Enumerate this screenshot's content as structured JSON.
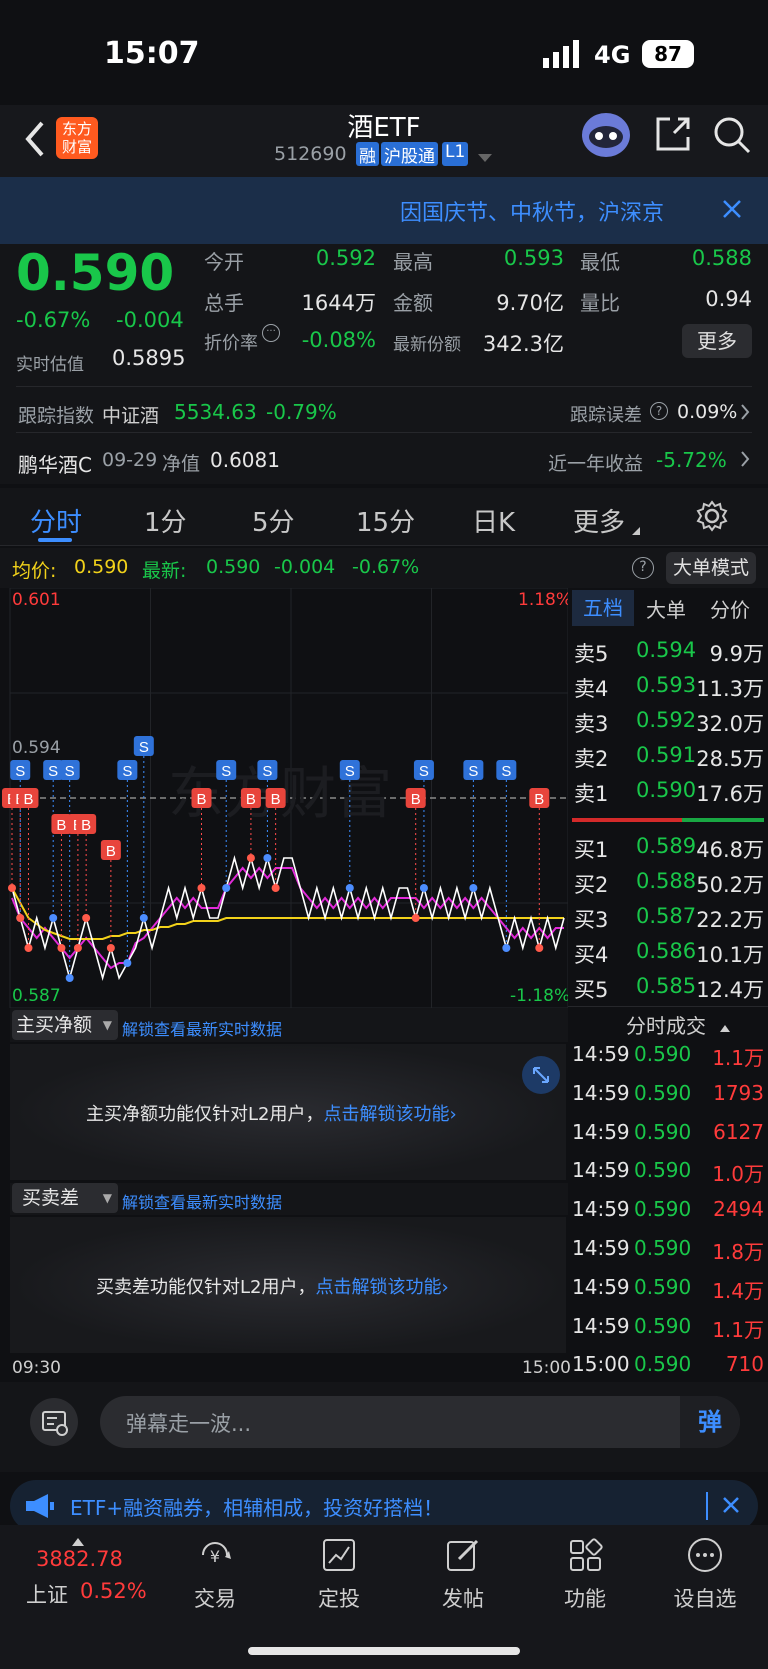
{
  "status": {
    "time": "15:07",
    "network": "4G",
    "battery": "87"
  },
  "nav": {
    "title": "酒ETF",
    "code": "512690",
    "badges": [
      "融",
      "沪股通",
      "L1"
    ],
    "logo_line1": "东方",
    "logo_line2": "财富"
  },
  "notice": {
    "text": "因国庆节、中秋节，沪深京"
  },
  "quote": {
    "price": "0.590",
    "change_pct": "-0.67%",
    "change": "-0.004",
    "estimate_label": "实时估值",
    "estimate": "0.5895",
    "fields": [
      {
        "label": "今开",
        "value": "0.592",
        "color": "green"
      },
      {
        "label": "最高",
        "value": "0.593",
        "color": "green"
      },
      {
        "label": "最低",
        "value": "0.588",
        "color": "green"
      },
      {
        "label": "总手",
        "value": "1644万",
        "color": "white"
      },
      {
        "label": "金额",
        "value": "9.70亿",
        "color": "white"
      },
      {
        "label": "量比",
        "value": "0.94",
        "color": "white"
      },
      {
        "label": "折价率",
        "value": "-0.08%",
        "color": "green"
      },
      {
        "label": "最新份额",
        "value": "342.3亿",
        "color": "white"
      }
    ],
    "more_button": "更多",
    "track_label": "跟踪指数",
    "track_index": "中证酒",
    "track_value": "5534.63",
    "track_pct": "-0.79%",
    "track_error_label": "跟踪误差",
    "track_error": "0.09%",
    "fund_name": "鹏华酒C",
    "fund_date": "09-29",
    "nav_label": "净值",
    "nav_value": "0.6081",
    "year_return_label": "近一年收益",
    "year_return": "-5.72%"
  },
  "tabs": [
    "分时",
    "1分",
    "5分",
    "15分",
    "日K",
    "更多"
  ],
  "chartbar": {
    "avg_label": "均价:",
    "avg": "0.590",
    "latest_label": "最新:",
    "latest": "0.590",
    "latest_change": "-0.004",
    "latest_pct": "-0.67%",
    "mode_button": "大单模式"
  },
  "chart_data": {
    "type": "line",
    "y_max_label": "0.601",
    "y_min_label": "0.587",
    "pct_max_label": "1.18%",
    "pct_min_label": "-1.18%",
    "ref_label": "0.594",
    "ylim": [
      0.587,
      0.601
    ],
    "x_start": "09:30",
    "x_end": "15:00",
    "watermark": "东方财富",
    "series": [
      {
        "name": "price",
        "color": "#ffffff",
        "values": [
          0.591,
          0.59,
          0.589,
          0.59,
          0.589,
          0.59,
          0.589,
          0.588,
          0.589,
          0.59,
          0.589,
          0.588,
          0.589,
          0.588,
          0.5885,
          0.589,
          0.59,
          0.589,
          0.59,
          0.591,
          0.59,
          0.591,
          0.59,
          0.591,
          0.59,
          0.59,
          0.591,
          0.592,
          0.591,
          0.592,
          0.591,
          0.592,
          0.591,
          0.592,
          0.592,
          0.591,
          0.59,
          0.591,
          0.59,
          0.591,
          0.59,
          0.591,
          0.59,
          0.591,
          0.59,
          0.591,
          0.59,
          0.591,
          0.591,
          0.59,
          0.591,
          0.59,
          0.591,
          0.59,
          0.591,
          0.59,
          0.591,
          0.59,
          0.591,
          0.59,
          0.589,
          0.59,
          0.589,
          0.59,
          0.589,
          0.59,
          0.589,
          0.59
        ]
      },
      {
        "name": "avg",
        "color": "#f2d21a",
        "values": [
          0.591,
          0.5905,
          0.59,
          0.5898,
          0.5896,
          0.5895,
          0.5894,
          0.5893,
          0.5893,
          0.5893,
          0.5893,
          0.5893,
          0.5894,
          0.5894,
          0.5895,
          0.5895,
          0.5896,
          0.5896,
          0.5897,
          0.5897,
          0.5898,
          0.5898,
          0.5899,
          0.5899,
          0.5899,
          0.5899,
          0.59,
          0.59,
          0.59,
          0.59,
          0.59,
          0.59,
          0.59,
          0.59,
          0.59,
          0.59,
          0.59,
          0.59,
          0.59,
          0.59,
          0.59,
          0.59,
          0.59,
          0.59,
          0.59,
          0.59,
          0.59,
          0.59,
          0.59,
          0.59,
          0.59,
          0.59,
          0.59,
          0.59,
          0.59,
          0.59,
          0.59,
          0.59,
          0.59,
          0.59,
          0.59,
          0.59,
          0.59,
          0.59,
          0.59,
          0.59,
          0.59,
          0.59
        ]
      }
    ],
    "markers_S": [
      1,
      5,
      7,
      14,
      16,
      26,
      31,
      41,
      50,
      56,
      60
    ],
    "markers_B": [
      0,
      1,
      2,
      6,
      8,
      9,
      12,
      23,
      29,
      32,
      49,
      64
    ]
  },
  "book": {
    "tabs": [
      "五档",
      "大单",
      "分价"
    ],
    "asks": [
      {
        "label": "卖5",
        "price": "0.594",
        "vol": "9.9万"
      },
      {
        "label": "卖4",
        "price": "0.593",
        "vol": "11.3万"
      },
      {
        "label": "卖3",
        "price": "0.592",
        "vol": "32.0万"
      },
      {
        "label": "卖2",
        "price": "0.591",
        "vol": "28.5万"
      },
      {
        "label": "卖1",
        "price": "0.590",
        "vol": "17.6万"
      }
    ],
    "bids": [
      {
        "label": "买1",
        "price": "0.589",
        "vol": "46.8万"
      },
      {
        "label": "买2",
        "price": "0.588",
        "vol": "50.2万"
      },
      {
        "label": "买3",
        "price": "0.587",
        "vol": "22.2万"
      },
      {
        "label": "买4",
        "price": "0.586",
        "vol": "10.1万"
      },
      {
        "label": "买5",
        "price": "0.585",
        "vol": "12.4万"
      }
    ],
    "ticks_title": "分时成交",
    "ticks": [
      {
        "time": "14:59",
        "price": "0.590",
        "vol": "1.1万"
      },
      {
        "time": "14:59",
        "price": "0.590",
        "vol": "1793"
      },
      {
        "time": "14:59",
        "price": "0.590",
        "vol": "6127"
      },
      {
        "time": "14:59",
        "price": "0.590",
        "vol": "1.0万"
      },
      {
        "time": "14:59",
        "price": "0.590",
        "vol": "2494"
      },
      {
        "time": "14:59",
        "price": "0.590",
        "vol": "1.8万"
      },
      {
        "time": "14:59",
        "price": "0.590",
        "vol": "1.4万"
      },
      {
        "time": "14:59",
        "price": "0.590",
        "vol": "1.1万"
      },
      {
        "time": "15:00",
        "price": "0.590",
        "vol": "710"
      }
    ]
  },
  "l2a": {
    "dropdown": "主买净额",
    "unlock_link": "解锁查看最新实时数据",
    "message": "主买净额功能仅针对L2用户，",
    "message_link": "点击解锁该功能"
  },
  "l2b": {
    "dropdown": "买卖差",
    "unlock_link": "解锁查看最新实时数据",
    "message": "买卖差功能仅针对L2用户，",
    "message_link": "点击解锁该功能"
  },
  "danmu": {
    "placeholder": "弹幕走一波...",
    "send": "弹"
  },
  "promo": {
    "text": "ETF+融资融券，相辅相成，投资好搭档！"
  },
  "bottomnav": {
    "index_value": "3882.78",
    "index_name": "上证",
    "index_pct": "0.52%",
    "items": [
      "交易",
      "定投",
      "发帖",
      "功能",
      "设自选"
    ]
  }
}
